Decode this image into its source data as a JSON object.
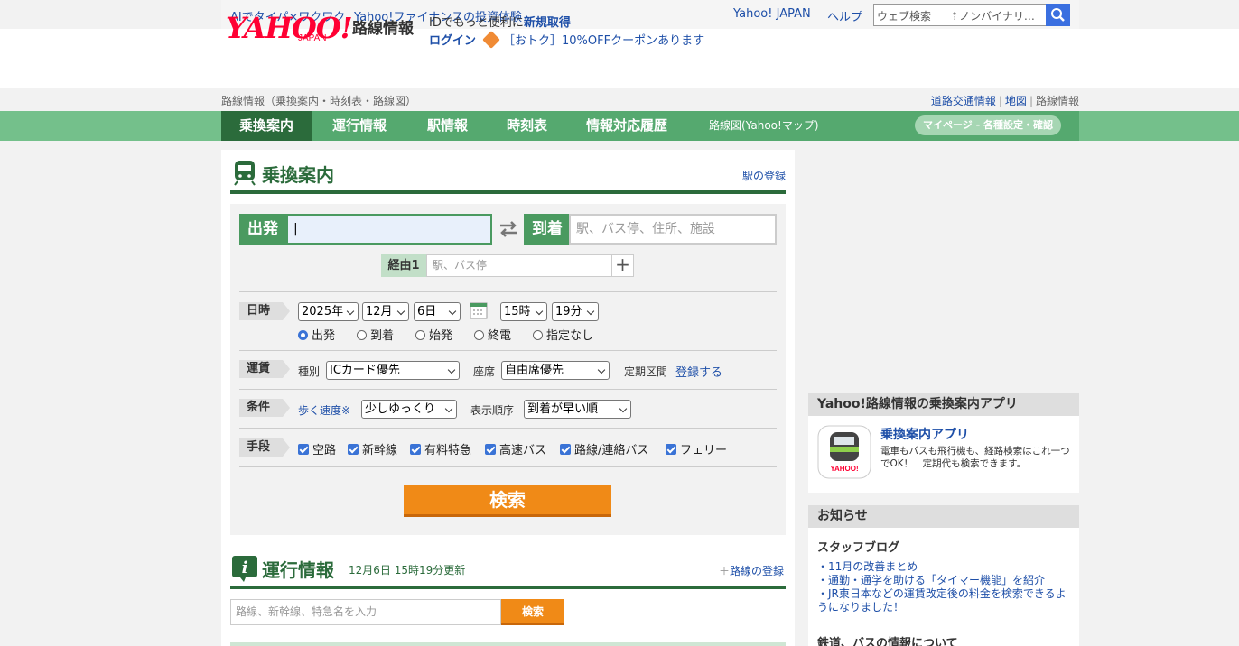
{
  "topbar": {
    "links_left": [
      "AIでタイパ×ワクワク",
      "Yahoo!ファイナンスの投資体験"
    ],
    "links_right": [
      "Yahoo! JAPAN",
      "ヘルプ"
    ],
    "web_search_label": "ウェブ検索",
    "web_search_value": "ノンバイナリ…"
  },
  "header": {
    "logo": "YAHOO!",
    "logo_sub": "JAPAN",
    "title": "路線情報",
    "promo_line1_prefix": "IDでもっと便利に",
    "promo_line1_link": "新規取得",
    "login": "ログイン",
    "coupon": "［おトク］10%OFFクーポンあります"
  },
  "breadcrumb": "路線情報（乗換案内・時刻表・路線図）",
  "right_links": [
    "道路交通情報",
    "地図",
    "路線情報"
  ],
  "nav": {
    "items": [
      "乗換案内",
      "運行情報",
      "駅情報",
      "時刻表",
      "情報対応履歴",
      "路線図(Yahoo!マップ)"
    ],
    "mypage": "マイページ - 各種設定・確認"
  },
  "transfer": {
    "title": "乗換案内",
    "register_station": "駅の登録",
    "from_label": "出発",
    "from_value": "",
    "to_label": "到着",
    "to_placeholder": "駅、バス停、住所、施設",
    "via_label": "経由1",
    "via_placeholder": "駅、バス停",
    "datetime_label": "日時",
    "year": "2025年",
    "month": "12月",
    "day": "6日",
    "hour": "15時",
    "minute": "19分",
    "time_options": [
      "出発",
      "到着",
      "始発",
      "終電",
      "指定なし"
    ],
    "selected_time_option": "出発",
    "fare_label": "運賃",
    "kind_label": "種別",
    "kind_value": "ICカード優先",
    "seat_label": "座席",
    "seat_value": "自由席優先",
    "commuter_label": "定期区間",
    "commuter_link": "登録する",
    "cond_label": "条件",
    "walk_label": "歩く速度※",
    "walk_value": "少しゆっくり",
    "order_label": "表示順序",
    "order_value": "到着が早い順",
    "means_label": "手段",
    "means": [
      "空路",
      "新幹線",
      "有料特急",
      "高速バス",
      "路線/連絡バス",
      "フェリー"
    ],
    "search_button": "検索"
  },
  "operation": {
    "title": "運行情報",
    "updated": "12月6日 15時19分更新",
    "register_line": "路線の登録",
    "search_placeholder": "路線、新幹線、特急名を入力",
    "search_button": "検索"
  },
  "app_promo": {
    "heading": "Yahoo!路線情報の乗換案内アプリ",
    "title": "乗換案内アプリ",
    "desc": "電車もバスも飛行機も、経路検索はこれ一つでOK！　定期代も検索できます。"
  },
  "news": {
    "heading": "お知らせ",
    "blog_title": "スタッフブログ",
    "items": [
      "・11月の改善まとめ",
      "・通勤・通学を助ける「タイマー機能」を紹介",
      "・JR東日本などの運賃改定後の料金を検索できるようになりました！"
    ],
    "next_title": "鉄道、バスの情報について"
  },
  "colors": {
    "primary_green": "#2b6b3b",
    "nav_green": "#55a96f",
    "label_green": "#4a9a60",
    "orange": "#f08a17",
    "link_blue": "#1e4fa8"
  }
}
